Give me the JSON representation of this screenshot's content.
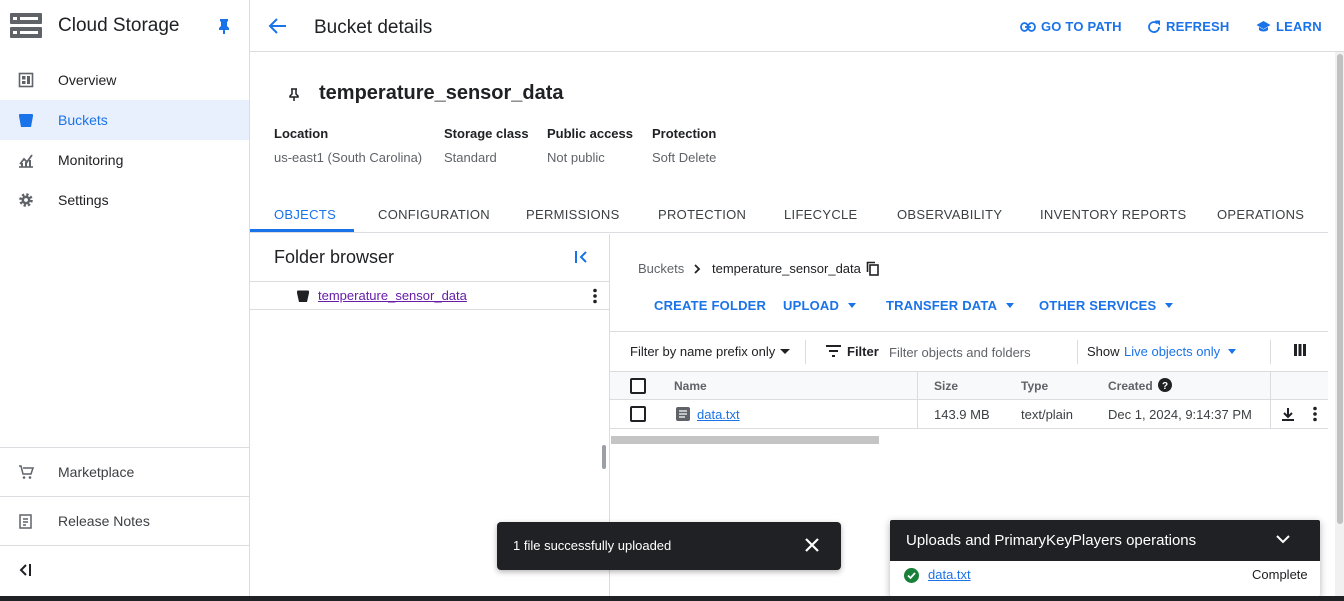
{
  "app": {
    "title": "Cloud Storage"
  },
  "sidebar": {
    "items": [
      {
        "label": "Overview",
        "icon": "dashboard-icon"
      },
      {
        "label": "Buckets",
        "icon": "bucket-icon",
        "active": true
      },
      {
        "label": "Monitoring",
        "icon": "chart-icon"
      },
      {
        "label": "Settings",
        "icon": "gear-icon"
      }
    ],
    "bottom_items": [
      {
        "label": "Marketplace",
        "icon": "cart-icon"
      },
      {
        "label": "Release Notes",
        "icon": "notes-icon"
      }
    ]
  },
  "header": {
    "title": "Bucket details",
    "actions": {
      "go_to_path": "GO TO PATH",
      "refresh": "REFRESH",
      "learn": "LEARN"
    }
  },
  "bucket": {
    "name": "temperature_sensor_data",
    "meta": [
      {
        "label": "Location",
        "value": "us-east1 (South Carolina)"
      },
      {
        "label": "Storage class",
        "value": "Standard"
      },
      {
        "label": "Public access",
        "value": "Not public"
      },
      {
        "label": "Protection",
        "value": "Soft Delete"
      }
    ]
  },
  "tabs": [
    "OBJECTS",
    "CONFIGURATION",
    "PERMISSIONS",
    "PROTECTION",
    "LIFECYCLE",
    "OBSERVABILITY",
    "INVENTORY REPORTS",
    "OPERATIONS"
  ],
  "folder_browser": {
    "title": "Folder browser",
    "item": "temperature_sensor_data"
  },
  "objects": {
    "breadcrumb_root": "Buckets",
    "breadcrumb_current": "temperature_sensor_data",
    "actions": {
      "create_folder": "CREATE FOLDER",
      "upload": "UPLOAD",
      "transfer_data": "TRANSFER DATA",
      "other_services": "OTHER SERVICES"
    },
    "filter": {
      "mode": "Filter by name prefix only",
      "label": "Filter",
      "placeholder": "Filter objects and folders",
      "show_label": "Show",
      "show_value": "Live objects only"
    },
    "columns": [
      "Name",
      "Size",
      "Type",
      "Created"
    ],
    "rows": [
      {
        "name": "data.txt",
        "size": "143.9 MB",
        "type": "text/plain",
        "created": "Dec 1, 2024, 9:14:37 PM"
      }
    ]
  },
  "snackbar": {
    "message": "1 file successfully uploaded"
  },
  "upload_panel": {
    "title": "Uploads and PrimaryKeyPlayers operations",
    "file": "data.txt",
    "status": "Complete"
  },
  "colors": {
    "accent": "#1a73e8",
    "active_bg": "#e8f0fe",
    "success": "#188038",
    "dark": "#202124"
  }
}
